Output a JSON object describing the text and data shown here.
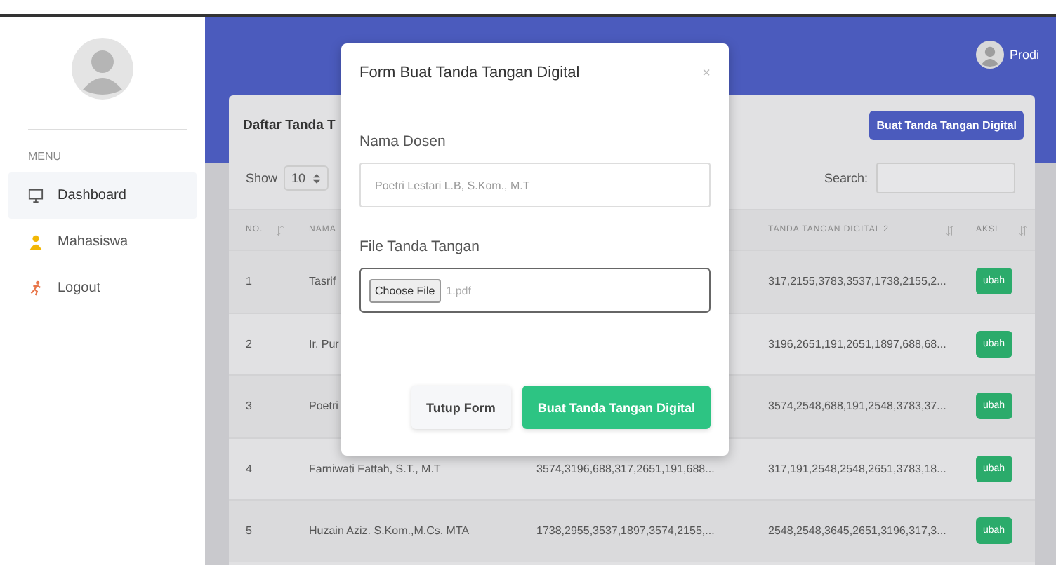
{
  "sidebar": {
    "menu_label": "MENU",
    "items": [
      {
        "label": "Dashboard",
        "kind": "monitor",
        "selected": true
      },
      {
        "label": "Mahasiswa",
        "kind": "user",
        "selected": false
      },
      {
        "label": "Logout",
        "kind": "run",
        "selected": false
      }
    ]
  },
  "header": {
    "user": "Prodi"
  },
  "card": {
    "title": "Daftar Tanda T",
    "create_button": "Buat Tanda Tangan Digital",
    "show_label": "Show",
    "page_size": "10",
    "search_label": "Search:"
  },
  "table": {
    "header": {
      "no": "NO.",
      "nama": "NAMA",
      "tanda_tangan_digital_2": "TANDA TANGAN DIGITAL 2",
      "aksi": "AKSI"
    },
    "rows": [
      {
        "no": "1",
        "nama": "Tasrif",
        "tanda_tangan_digital_2": "317,2155,3783,3537,1738,2155,2...",
        "aksi": "ubah"
      },
      {
        "no": "2",
        "nama": "Ir. Pur",
        "tanda_tangan_digital_2": "3196,2651,191,2651,1897,688,68...",
        "aksi": "ubah"
      },
      {
        "no": "3",
        "nama": "Poetri",
        "tanda_tangan_digital_2": "3574,2548,688,191,2548,3783,37...",
        "aksi": "ubah"
      },
      {
        "no": "4",
        "nama": "Farniwati Fattah, S.T., M.T",
        "column_3": "3574,3196,688,317,2651,191,688...",
        "tanda_tangan_digital_2": "317,191,2548,2548,2651,3783,18...",
        "aksi": "ubah"
      },
      {
        "no": "5",
        "nama": "Huzain Aziz. S.Kom.,M.Cs. MTA",
        "column_3": "1738,2955,3537,1897,3574,2155,...",
        "tanda_tangan_digital_2": "2548,2548,3645,2651,3196,317,3...",
        "aksi": "ubah"
      }
    ]
  },
  "modal": {
    "title": "Form Buat Tanda Tangan Digital",
    "close": "×",
    "fields": [
      {
        "label": "Nama Dosen",
        "kind": "text",
        "placeholder": "Poetri Lestari L.B, S.Kom., M.T"
      },
      {
        "label": "File Tanda Tangan",
        "kind": "file",
        "button": "Choose File",
        "value": "1.pdf"
      }
    ],
    "buttons": [
      {
        "label": "Tutup Form",
        "kind": "secondary"
      },
      {
        "label": "Buat Tanda Tangan Digital",
        "kind": "primary"
      }
    ]
  }
}
